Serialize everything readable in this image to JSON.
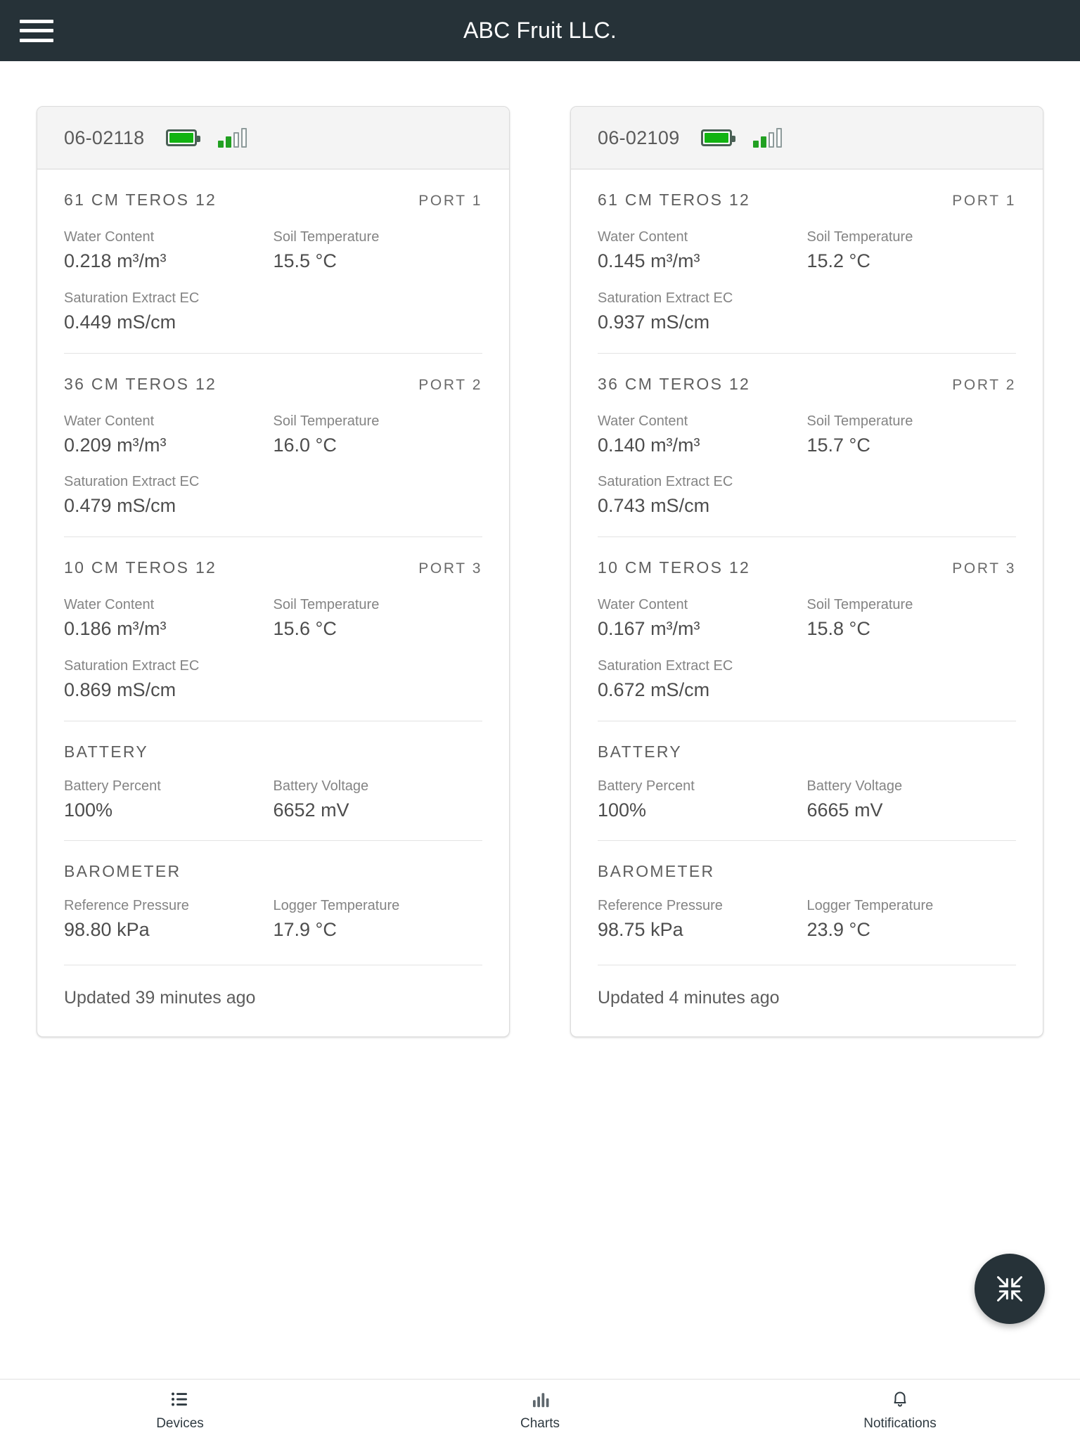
{
  "appbar": {
    "menu_icon": "hamburger-menu-icon",
    "title": "ABC Fruit LLC."
  },
  "fab": {
    "icon": "collapse-arrows-icon",
    "color": "#263238"
  },
  "colors": {
    "appbar_bg": "#263238",
    "battery_green": "#12b312",
    "signal_green": "#21a021",
    "card_border": "#dcdcdc"
  },
  "cards": [
    {
      "device_id": "06-02118",
      "battery_icon": "battery-full-icon",
      "signal_icon": "signal-bars-icon",
      "signal_bars_on": 2,
      "signal_bars_total": 4,
      "sensors": [
        {
          "name": "61 CM TEROS 12",
          "port": "PORT 1",
          "metrics": [
            {
              "label": "Water Content",
              "value": "0.218 m³/m³"
            },
            {
              "label": "Soil Temperature",
              "value": "15.5 °C"
            },
            {
              "label": "Saturation Extract EC",
              "value": "0.449 mS/cm"
            }
          ]
        },
        {
          "name": "36 CM TEROS 12",
          "port": "PORT 2",
          "metrics": [
            {
              "label": "Water Content",
              "value": "0.209 m³/m³"
            },
            {
              "label": "Soil Temperature",
              "value": "16.0 °C"
            },
            {
              "label": "Saturation Extract EC",
              "value": "0.479 mS/cm"
            }
          ]
        },
        {
          "name": "10 CM TEROS 12",
          "port": "PORT 3",
          "metrics": [
            {
              "label": "Water Content",
              "value": "0.186 m³/m³"
            },
            {
              "label": "Soil Temperature",
              "value": "15.6 °C"
            },
            {
              "label": "Saturation Extract EC",
              "value": "0.869 mS/cm"
            }
          ]
        }
      ],
      "battery": {
        "title": "BATTERY",
        "metrics": [
          {
            "label": "Battery Percent",
            "value": "100%"
          },
          {
            "label": "Battery Voltage",
            "value": "6652 mV"
          }
        ]
      },
      "barometer": {
        "title": "BAROMETER",
        "metrics": [
          {
            "label": "Reference Pressure",
            "value": "98.80 kPa"
          },
          {
            "label": "Logger Temperature",
            "value": "17.9 °C"
          }
        ]
      },
      "updated": "Updated 39 minutes ago"
    },
    {
      "device_id": "06-02109",
      "battery_icon": "battery-full-icon",
      "signal_icon": "signal-bars-icon",
      "signal_bars_on": 2,
      "signal_bars_total": 4,
      "sensors": [
        {
          "name": "61 CM TEROS 12",
          "port": "PORT 1",
          "metrics": [
            {
              "label": "Water Content",
              "value": "0.145 m³/m³"
            },
            {
              "label": "Soil Temperature",
              "value": "15.2 °C"
            },
            {
              "label": "Saturation Extract EC",
              "value": "0.937 mS/cm"
            }
          ]
        },
        {
          "name": "36 CM TEROS 12",
          "port": "PORT 2",
          "metrics": [
            {
              "label": "Water Content",
              "value": "0.140 m³/m³"
            },
            {
              "label": "Soil Temperature",
              "value": "15.7 °C"
            },
            {
              "label": "Saturation Extract EC",
              "value": "0.743 mS/cm"
            }
          ]
        },
        {
          "name": "10 CM TEROS 12",
          "port": "PORT 3",
          "metrics": [
            {
              "label": "Water Content",
              "value": "0.167 m³/m³"
            },
            {
              "label": "Soil Temperature",
              "value": "15.8 °C"
            },
            {
              "label": "Saturation Extract EC",
              "value": "0.672 mS/cm"
            }
          ]
        }
      ],
      "battery": {
        "title": "BATTERY",
        "metrics": [
          {
            "label": "Battery Percent",
            "value": "100%"
          },
          {
            "label": "Battery Voltage",
            "value": "6665 mV"
          }
        ]
      },
      "barometer": {
        "title": "BAROMETER",
        "metrics": [
          {
            "label": "Reference Pressure",
            "value": "98.75 kPa"
          },
          {
            "label": "Logger Temperature",
            "value": "23.9 °C"
          }
        ]
      },
      "updated": "Updated 4 minutes ago"
    }
  ],
  "bottomnav": {
    "items": [
      {
        "label": "Devices",
        "icon": "list-icon"
      },
      {
        "label": "Charts",
        "icon": "bar-chart-icon"
      },
      {
        "label": "Notifications",
        "icon": "bell-icon"
      }
    ]
  }
}
